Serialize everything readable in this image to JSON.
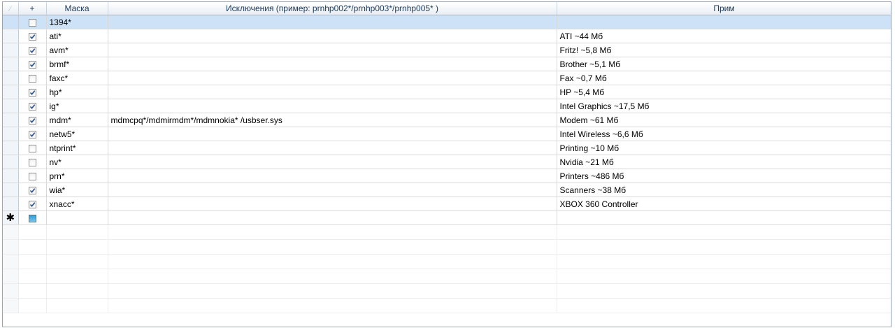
{
  "header": {
    "corner_icon": "pencil-icon",
    "add_label": "+",
    "mask_label": "Маска",
    "exclusions_label": "Исключения (пример: prnhp002*/prnhp003*/prnhp005* )",
    "note_label": "Прим"
  },
  "rows": [
    {
      "checked": false,
      "mask": "1394*",
      "exclusions": "",
      "note": ""
    },
    {
      "checked": true,
      "mask": "ati*",
      "exclusions": "",
      "note": "ATI ~44 Мб"
    },
    {
      "checked": true,
      "mask": "avm*",
      "exclusions": "",
      "note": "Fritz! ~5,8 Мб"
    },
    {
      "checked": true,
      "mask": "brmf*",
      "exclusions": "",
      "note": "Brother ~5,1 Мб"
    },
    {
      "checked": false,
      "mask": "faxc*",
      "exclusions": "",
      "note": "Fax ~0,7 Мб"
    },
    {
      "checked": true,
      "mask": "hp*",
      "exclusions": "",
      "note": "HP ~5,4 Мб"
    },
    {
      "checked": true,
      "mask": "ig*",
      "exclusions": "",
      "note": "Intel Graphics ~17,5 Мб"
    },
    {
      "checked": true,
      "mask": "mdm*",
      "exclusions": "mdmcpq*/mdmirmdm*/mdmnokia* /usbser.sys",
      "note": "Modem ~61 Мб"
    },
    {
      "checked": true,
      "mask": "netw5*",
      "exclusions": "",
      "note": "Intel Wireless ~6,6 Мб"
    },
    {
      "checked": false,
      "mask": "ntprint*",
      "exclusions": "",
      "note": "Printing ~10 Мб"
    },
    {
      "checked": false,
      "mask": "nv*",
      "exclusions": "",
      "note": "Nvidia ~21 Мб"
    },
    {
      "checked": false,
      "mask": "prn*",
      "exclusions": "",
      "note": "Printers ~486 Мб"
    },
    {
      "checked": true,
      "mask": "wia*",
      "exclusions": "",
      "note": "Scanners ~38 Мб"
    },
    {
      "checked": true,
      "mask": "xnacc*",
      "exclusions": "",
      "note": "XBOX 360 Controller"
    }
  ],
  "new_row": {
    "marker": "✱",
    "marker_icon": "asterisk-icon"
  },
  "colors": {
    "selected_row": "#cde1f7",
    "grid_line": "#d9d9d9",
    "new_checkbox": "#2f9ad1"
  }
}
